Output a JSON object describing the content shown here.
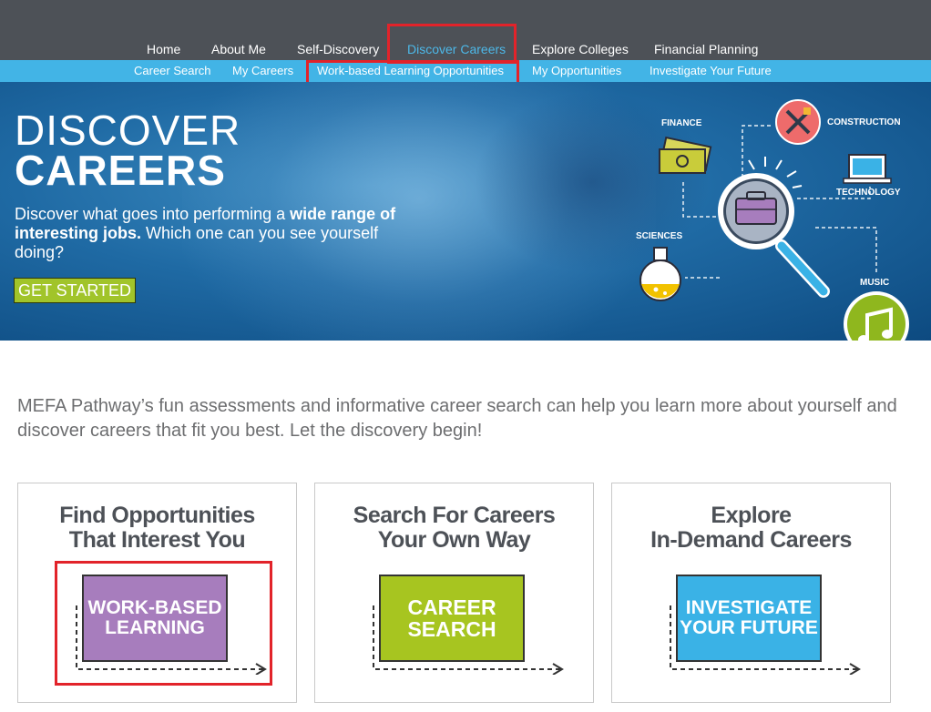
{
  "nav": {
    "items": [
      {
        "label": "Home"
      },
      {
        "label": "About Me"
      },
      {
        "label": "Self-Discovery"
      },
      {
        "label": "Discover Careers"
      },
      {
        "label": "Explore Colleges"
      },
      {
        "label": "Financial Planning"
      }
    ],
    "active": "Discover Careers"
  },
  "subnav": {
    "items": [
      {
        "label": "Career Search"
      },
      {
        "label": "My Careers"
      },
      {
        "label": "Work-based Learning Opportunities"
      },
      {
        "label": "My Opportunities"
      },
      {
        "label": "Investigate Your Future"
      }
    ]
  },
  "hero": {
    "title_line1": "DISCOVER",
    "title_line2": "CAREERS",
    "desc_part1": "Discover what goes into performing a ",
    "desc_bold1": "wide range of interesting jobs.",
    "desc_part2": " Which one can you see yourself doing?",
    "button": "GET STARTED",
    "icons": {
      "finance": "FINANCE",
      "construction": "CONSTRUCTION",
      "technology": "TECHNOLOGY",
      "sciences": "SCIENCES",
      "music": "MUSIC"
    }
  },
  "intro": "MEFA Pathway’s fun assessments and informative career search can help you learn more about yourself and discover careers that fit you best. Let the discovery begin!",
  "cards": [
    {
      "title1": "Find Opportunities",
      "title2": "That Interest You",
      "tile1": "WORK-BASED",
      "tile2": "LEARNING",
      "color": "#a77dbd"
    },
    {
      "title1": "Search For Careers",
      "title2": "Your Own Way",
      "tile1": "CAREER",
      "tile2": "SEARCH",
      "color": "#a7c520"
    },
    {
      "title1": "Explore",
      "title2": "In-Demand Careers",
      "tile1": "INVESTIGATE",
      "tile2": "YOUR FUTURE",
      "color": "#3ab2e6"
    }
  ],
  "colors": {
    "nav_bg": "#4d5157",
    "subnav_bg": "#42b4e6",
    "accent_green": "#a1c42a",
    "highlight_red": "#e2232a"
  }
}
